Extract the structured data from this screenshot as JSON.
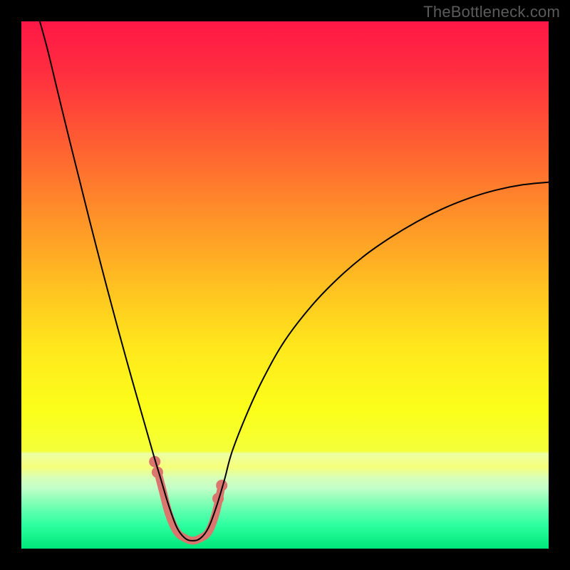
{
  "watermark": {
    "text": "TheBottleneck.com"
  },
  "gradient": {
    "stops": [
      {
        "offset": 0.0,
        "color": "#ff1746"
      },
      {
        "offset": 0.1,
        "color": "#ff2f3f"
      },
      {
        "offset": 0.22,
        "color": "#ff5a33"
      },
      {
        "offset": 0.35,
        "color": "#ff8a2a"
      },
      {
        "offset": 0.5,
        "color": "#ffc021"
      },
      {
        "offset": 0.62,
        "color": "#ffe81c"
      },
      {
        "offset": 0.74,
        "color": "#fbff1a"
      },
      {
        "offset": 0.815,
        "color": "#f4ff3a"
      },
      {
        "offset": 0.82,
        "color": "#ecffa5"
      },
      {
        "offset": 0.845,
        "color": "#f6ff7a"
      },
      {
        "offset": 0.865,
        "color": "#d8ffb8"
      },
      {
        "offset": 0.885,
        "color": "#c2ffc9"
      },
      {
        "offset": 0.905,
        "color": "#93ffba"
      },
      {
        "offset": 0.93,
        "color": "#5cffad"
      },
      {
        "offset": 0.955,
        "color": "#2effa0"
      },
      {
        "offset": 1.0,
        "color": "#00e77a"
      }
    ]
  },
  "chart_data": {
    "type": "line",
    "title": "",
    "xlabel": "",
    "ylabel": "",
    "xlim": [
      0,
      1
    ],
    "ylim": [
      0,
      1
    ],
    "note": "V-shaped bottleneck curve. Black main curve descends from top-left, reaches a rounded well around x≈0.32 at y≈0.02, then rises to the right edge at y≈0.69. A coral highlight segment sits in and around the well between x≈0.26 and x≈0.38 with two slightly raised beads on each side of the valley.",
    "series": [
      {
        "name": "bottleneck-curve",
        "color": "#000000",
        "width": 2,
        "x": [
          0.035,
          0.05,
          0.07,
          0.09,
          0.11,
          0.13,
          0.15,
          0.17,
          0.19,
          0.21,
          0.23,
          0.25,
          0.265,
          0.28,
          0.295,
          0.31,
          0.325,
          0.34,
          0.355,
          0.37,
          0.385,
          0.4,
          0.43,
          0.46,
          0.5,
          0.55,
          0.6,
          0.65,
          0.7,
          0.75,
          0.8,
          0.85,
          0.9,
          0.95,
          1.0
        ],
        "y": [
          1.0,
          0.945,
          0.862,
          0.78,
          0.7,
          0.62,
          0.542,
          0.466,
          0.392,
          0.32,
          0.25,
          0.18,
          0.13,
          0.08,
          0.04,
          0.02,
          0.015,
          0.02,
          0.04,
          0.08,
          0.13,
          0.185,
          0.261,
          0.325,
          0.395,
          0.46,
          0.512,
          0.555,
          0.59,
          0.62,
          0.645,
          0.665,
          0.68,
          0.69,
          0.695
        ]
      },
      {
        "name": "optimal-range-highlight",
        "color": "#db766f",
        "width": 11,
        "x": [
          0.258,
          0.268,
          0.28,
          0.295,
          0.31,
          0.325,
          0.34,
          0.355,
          0.368,
          0.378
        ],
        "y": [
          0.148,
          0.11,
          0.065,
          0.032,
          0.02,
          0.015,
          0.02,
          0.032,
          0.065,
          0.11
        ]
      }
    ],
    "beads": {
      "color": "#db766f",
      "r": 8,
      "points": [
        {
          "x": 0.253,
          "y": 0.165
        },
        {
          "x": 0.258,
          "y": 0.145
        },
        {
          "x": 0.373,
          "y": 0.095
        },
        {
          "x": 0.38,
          "y": 0.12
        }
      ]
    }
  }
}
